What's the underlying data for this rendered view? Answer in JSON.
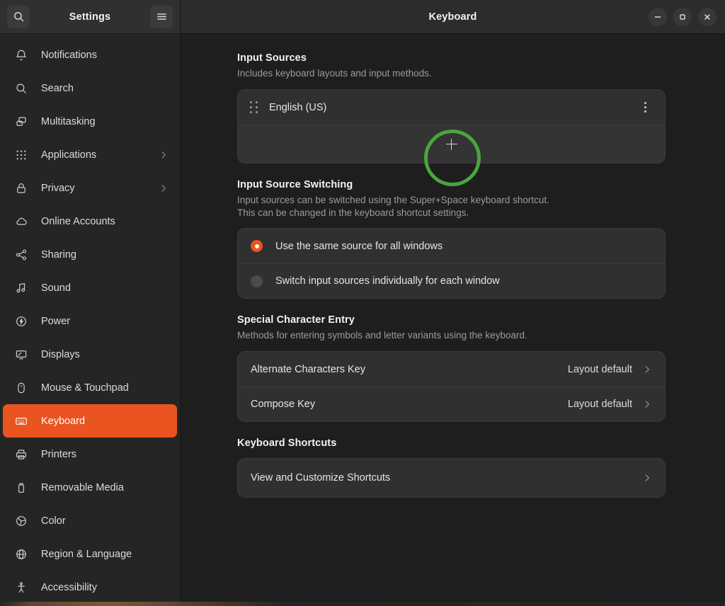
{
  "window": {
    "sidebar_title": "Settings",
    "content_title": "Keyboard",
    "search_icon": "search-icon",
    "menu_icon": "hamburger-menu-icon",
    "minimize_label": "–",
    "maximize_label": "□",
    "close_label": "×"
  },
  "sidebar": {
    "items": [
      {
        "label": "Notifications",
        "icon": "bell-icon",
        "chevron": false,
        "active": false
      },
      {
        "label": "Search",
        "icon": "search-icon",
        "chevron": false,
        "active": false
      },
      {
        "label": "Multitasking",
        "icon": "windows-icon",
        "chevron": false,
        "active": false
      },
      {
        "label": "Applications",
        "icon": "grid-dots-icon",
        "chevron": true,
        "active": false
      },
      {
        "label": "Privacy",
        "icon": "lock-icon",
        "chevron": true,
        "active": false
      },
      {
        "label": "Online Accounts",
        "icon": "cloud-icon",
        "chevron": false,
        "active": false
      },
      {
        "label": "Sharing",
        "icon": "share-nodes-icon",
        "chevron": false,
        "active": false
      },
      {
        "label": "Sound",
        "icon": "music-note-icon",
        "chevron": false,
        "active": false
      },
      {
        "label": "Power",
        "icon": "power-bolt-icon",
        "chevron": false,
        "active": false
      },
      {
        "label": "Displays",
        "icon": "monitor-icon",
        "chevron": false,
        "active": false
      },
      {
        "label": "Mouse & Touchpad",
        "icon": "mouse-icon",
        "chevron": false,
        "active": false
      },
      {
        "label": "Keyboard",
        "icon": "keyboard-icon",
        "chevron": false,
        "active": true
      },
      {
        "label": "Printers",
        "icon": "printer-icon",
        "chevron": false,
        "active": false
      },
      {
        "label": "Removable Media",
        "icon": "usb-drive-icon",
        "chevron": false,
        "active": false
      },
      {
        "label": "Color",
        "icon": "color-wheel-icon",
        "chevron": false,
        "active": false
      },
      {
        "label": "Region & Language",
        "icon": "globe-icon",
        "chevron": false,
        "active": false
      },
      {
        "label": "Accessibility",
        "icon": "accessibility-icon",
        "chevron": false,
        "active": false
      }
    ]
  },
  "main": {
    "input_sources": {
      "title": "Input Sources",
      "description": "Includes keyboard layouts and input methods.",
      "sources": [
        {
          "label": "English (US)"
        }
      ],
      "add_label": "+"
    },
    "input_source_switching": {
      "title": "Input Source Switching",
      "description_line1": "Input sources can be switched using the Super+Space keyboard shortcut.",
      "description_line2": "This can be changed in the keyboard shortcut settings.",
      "options": [
        {
          "label": "Use the same source for all windows",
          "selected": true
        },
        {
          "label": "Switch input sources individually for each window",
          "selected": false
        }
      ]
    },
    "special_character_entry": {
      "title": "Special Character Entry",
      "description": "Methods for entering symbols and letter variants using the keyboard.",
      "rows": [
        {
          "label": "Alternate Characters Key",
          "value": "Layout default"
        },
        {
          "label": "Compose Key",
          "value": "Layout default"
        }
      ]
    },
    "keyboard_shortcuts": {
      "title": "Keyboard Shortcuts",
      "rows": [
        {
          "label": "View and Customize Shortcuts",
          "value": ""
        }
      ]
    }
  },
  "annotation": {
    "highlight_target": "add-input-source-button",
    "highlight_color": "#4aa53f"
  },
  "colors": {
    "accent": "#e95420",
    "window_bg": "#1e1e1e",
    "sidebar_bg": "#252525",
    "card_bg": "#303030",
    "headerbar_bg": "#2c2c2c"
  }
}
